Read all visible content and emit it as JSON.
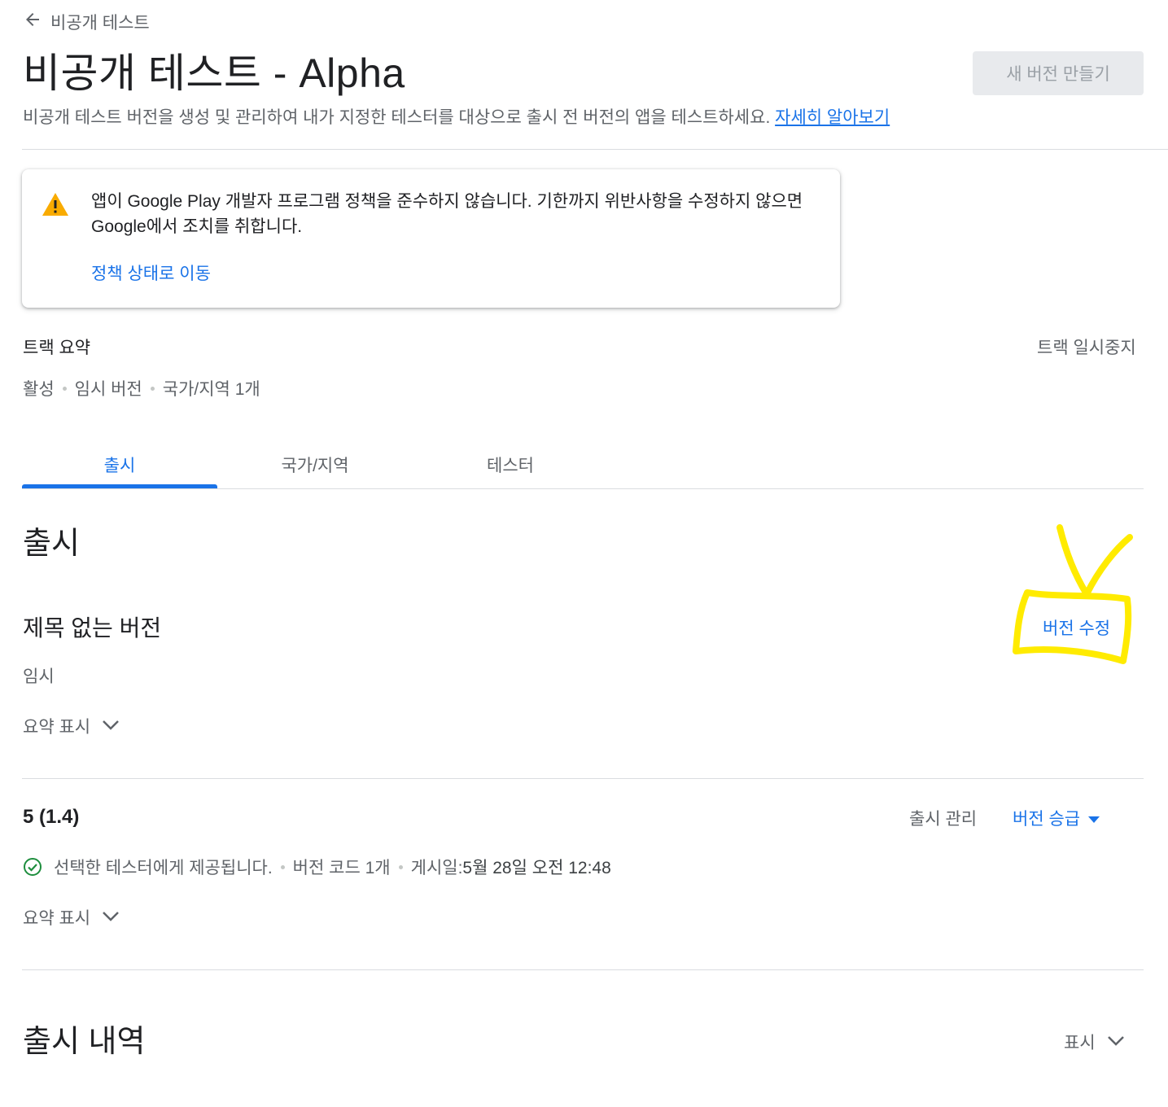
{
  "header": {
    "breadcrumb": "비공개 테스트",
    "title": "비공개 테스트 - Alpha",
    "new_release_label": "새 버전 만들기",
    "description": "비공개 테스트 버전을 생성 및 관리하여 내가 지정한 테스터를 대상으로 출시 전 버전의 앱을 테스트하세요.",
    "learn_more": "자세히 알아보기"
  },
  "warning": {
    "message": "앱이 Google Play 개발자 프로그램 정책을 준수하지 않습니다. 기한까지 위반사항을 수정하지 않으면 Google에서 조치를 취합니다.",
    "link": "정책 상태로 이동"
  },
  "track_summary": {
    "title": "트랙 요약",
    "pause": "트랙 일시중지",
    "meta": [
      "활성",
      "임시 버전",
      "국가/지역 1개"
    ]
  },
  "tabs": [
    {
      "label": "출시"
    },
    {
      "label": "국가/지역"
    },
    {
      "label": "테스터"
    }
  ],
  "main": {
    "section_title": "출시",
    "draft": {
      "title": "제목 없는 버전",
      "edit_label": "버전 수정",
      "status": "임시",
      "summary_toggle": "요약 표시"
    },
    "release": {
      "name": "5 (1.4)",
      "manage_label": "출시 관리",
      "promote_label": "버전 승급",
      "status_text": "선택한 테스터에게 제공됩니다.",
      "version_codes": "버전 코드 1개",
      "published_label": "게시일: ",
      "published_value": "5월 28일 오전 12:48",
      "summary_toggle": "요약 표시"
    },
    "history": {
      "title": "출시 내역",
      "show_label": "표시"
    }
  },
  "colors": {
    "accent": "#1a73e8",
    "warning": "#f9ab00",
    "success": "#1e8e3e",
    "annotation": "#ffeb00"
  }
}
